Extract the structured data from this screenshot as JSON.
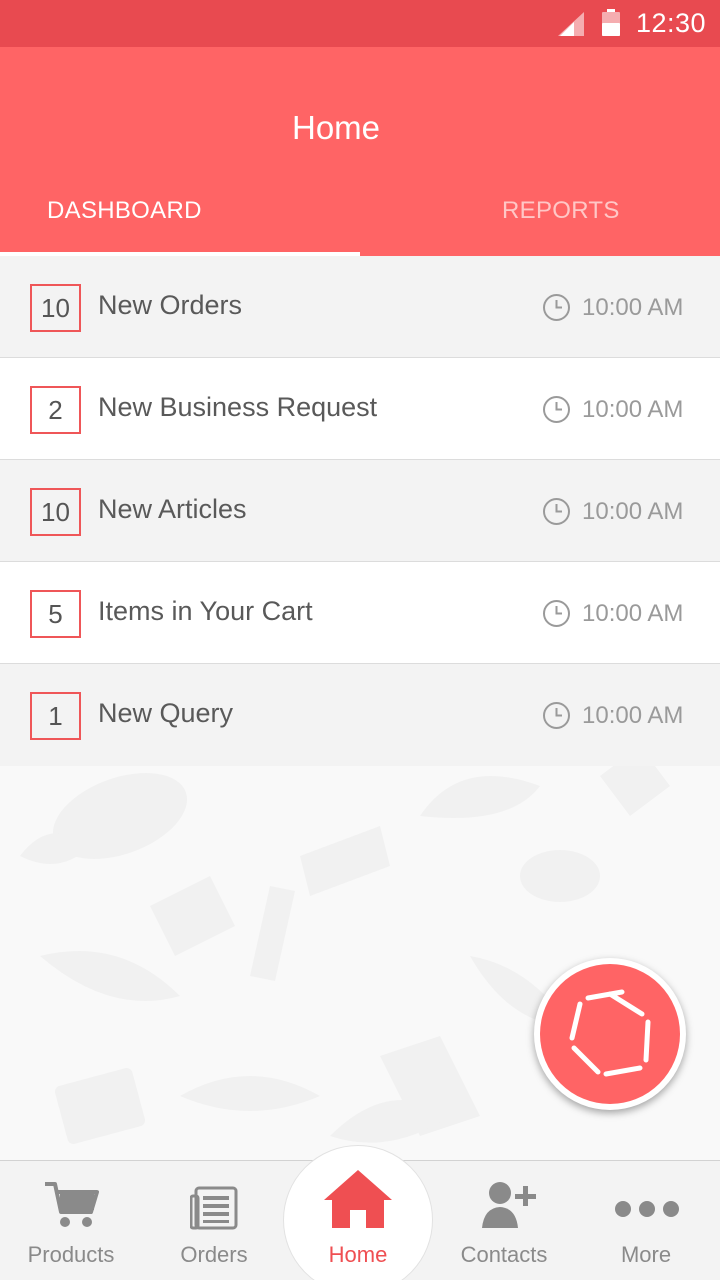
{
  "status_bar": {
    "time": "12:30"
  },
  "app_bar": {
    "title": "Home"
  },
  "tabs": [
    {
      "label": "DASHBOARD",
      "active": true
    },
    {
      "label": "REPORTS",
      "active": false
    }
  ],
  "dashboard_items": [
    {
      "count": "10",
      "label": "New Orders",
      "time": "10:00 AM"
    },
    {
      "count": "2",
      "label": "New Business Request",
      "time": "10:00 AM"
    },
    {
      "count": "10",
      "label": "New Articles",
      "time": "10:00 AM"
    },
    {
      "count": "5",
      "label": "Items in Your Cart",
      "time": "10:00 AM"
    },
    {
      "count": "1",
      "label": "New Query",
      "time": "10:00 AM"
    }
  ],
  "fab": {
    "icon": "camera-shutter-icon"
  },
  "bottom_nav": [
    {
      "label": "Products",
      "icon": "cart-icon",
      "active": false
    },
    {
      "label": "Orders",
      "icon": "orders-list-icon",
      "active": false
    },
    {
      "label": "Home",
      "icon": "home-icon",
      "active": true
    },
    {
      "label": "Contacts",
      "icon": "add-contact-icon",
      "active": false
    },
    {
      "label": "More",
      "icon": "more-dots-icon",
      "active": false
    }
  ],
  "colors": {
    "accent": "#ff6465",
    "status_bar": "#e84a50",
    "inactive": "#8a8a8a"
  }
}
